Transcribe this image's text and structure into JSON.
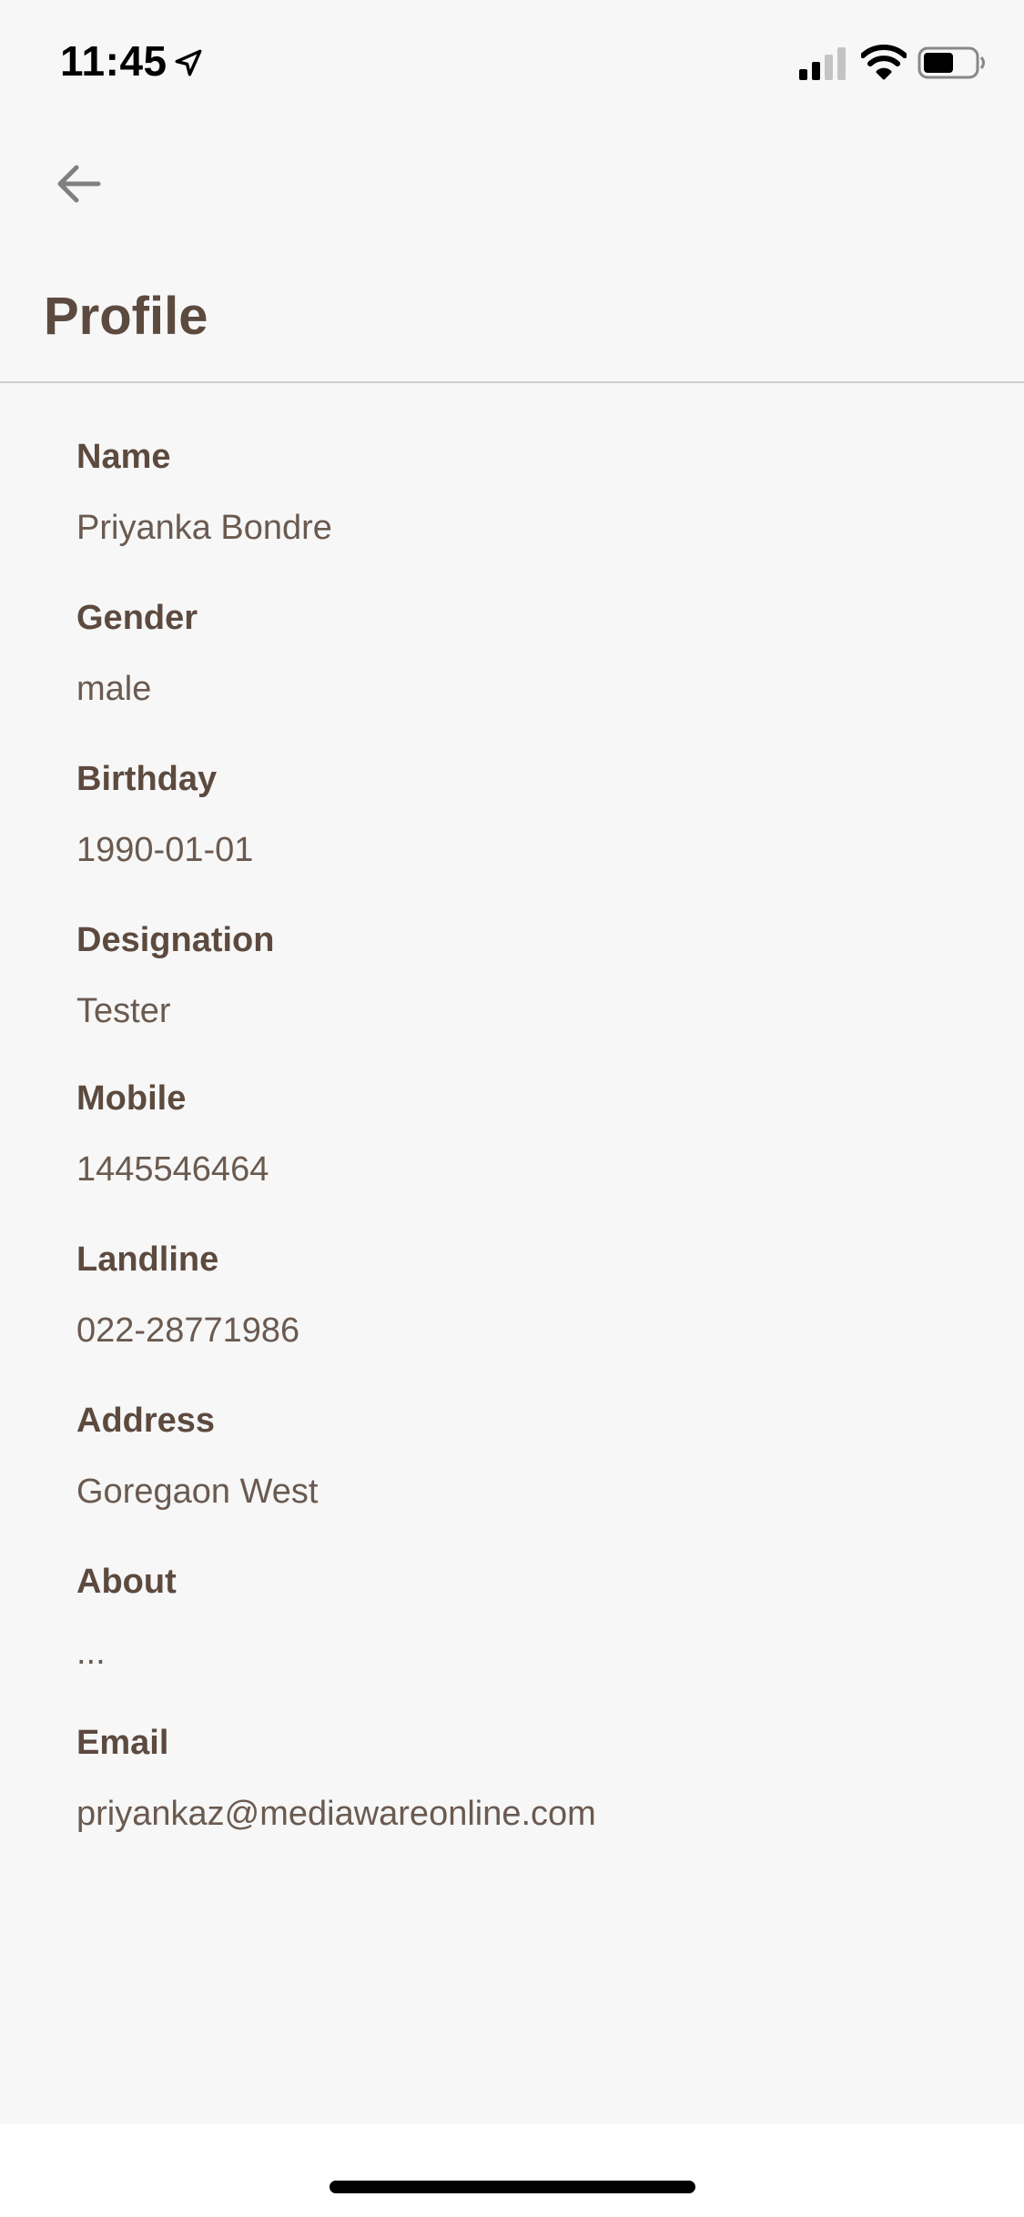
{
  "status_bar": {
    "time": "11:45"
  },
  "header": {
    "title": "Profile"
  },
  "profile": {
    "fields": [
      {
        "label": "Name",
        "value": "Priyanka Bondre"
      },
      {
        "label": "Gender",
        "value": "male"
      },
      {
        "label": "Birthday",
        "value": "1990-01-01"
      },
      {
        "label": "Designation",
        "value": "Tester"
      },
      {
        "label": "Mobile",
        "value": "1445546464"
      },
      {
        "label": "Landline",
        "value": "022-28771986"
      },
      {
        "label": "Address",
        "value": "Goregaon West"
      },
      {
        "label": "About",
        "value": "..."
      },
      {
        "label": "Email",
        "value": "priyankaz@mediawareonline.com"
      }
    ]
  },
  "icons": {
    "back": "arrow-left-icon",
    "location": "location-arrow-icon",
    "signal": "cellular-signal-icon",
    "wifi": "wifi-icon",
    "battery": "battery-icon"
  },
  "colors": {
    "background": "#f7f7f7",
    "title": "#5d4a3f",
    "label": "#5d4a3f",
    "value": "#6a5a50",
    "divider": "#cfcfcf"
  }
}
